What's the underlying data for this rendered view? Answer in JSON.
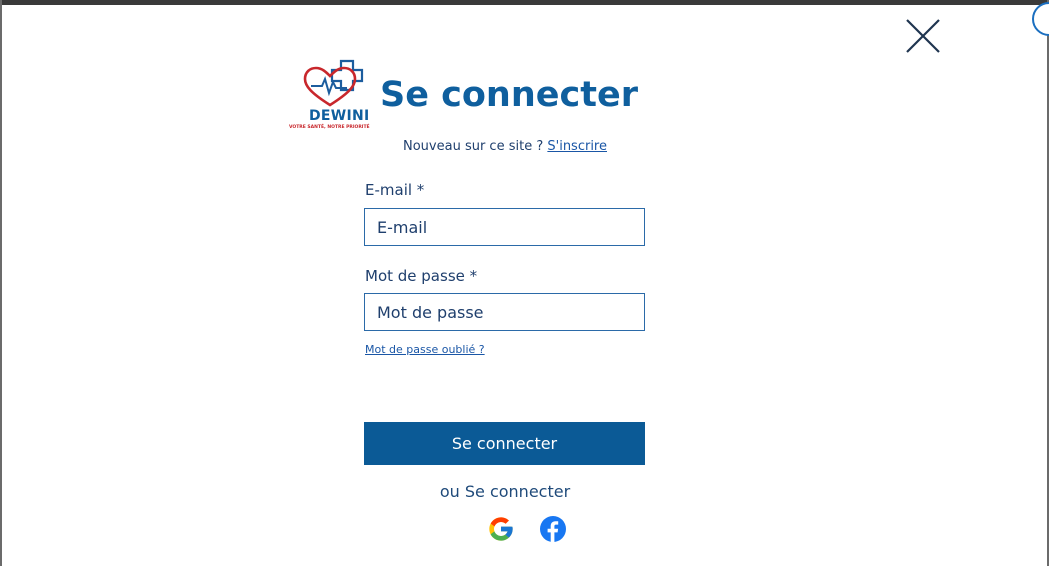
{
  "dialog": {
    "close_label": "Close",
    "logo": {
      "brand": "DEWINI",
      "tagline": "VOTRE SANTÉ, NOTRE PRIORITÉ"
    },
    "title": "Se connecter",
    "signup": {
      "prompt": "Nouveau sur ce site ?",
      "link": "S'inscrire"
    },
    "email": {
      "label": "E-mail *",
      "placeholder": "E-mail",
      "value": ""
    },
    "password": {
      "label": "Mot de passe *",
      "placeholder": "Mot de passe",
      "value": ""
    },
    "forgot_link": "Mot de passe oublié ?",
    "submit_label": "Se connecter",
    "alt_login": "ou Se connecter",
    "social": [
      {
        "name": "google-icon"
      },
      {
        "name": "facebook-icon"
      }
    ]
  },
  "colors": {
    "primary": "#0b5a96",
    "title": "#0f5f9e",
    "text": "#1f3f6d",
    "link": "#1a56a6",
    "logo_red": "#c8272c"
  }
}
